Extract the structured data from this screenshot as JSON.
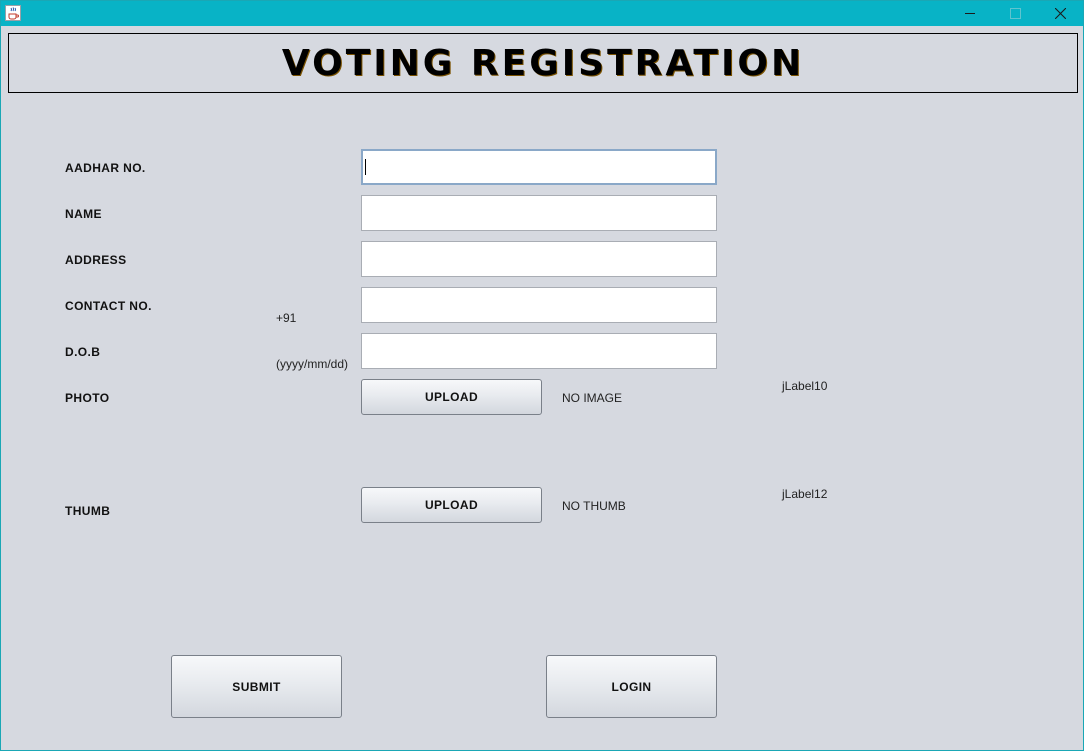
{
  "window": {
    "title": "",
    "controls": {
      "minimize": "minimize",
      "maximize": "maximize",
      "close": "close"
    }
  },
  "header": {
    "title": "VOTING REGISTRATION"
  },
  "form": {
    "aadhar": {
      "label": "AADHAR NO.",
      "value": ""
    },
    "name": {
      "label": "NAME",
      "value": ""
    },
    "address": {
      "label": "ADDRESS",
      "value": ""
    },
    "contact": {
      "label": "CONTACT NO.",
      "prefix": "+91",
      "value": ""
    },
    "dob": {
      "label": "D.O.B",
      "format_hint": "(yyyy/mm/dd)",
      "value": ""
    },
    "photo": {
      "label": "PHOTO",
      "button": "UPLOAD",
      "status": "NO IMAGE",
      "preview": "jLabel10"
    },
    "thumb": {
      "label": "THUMB",
      "button": "UPLOAD",
      "status": "NO THUMB",
      "preview": "jLabel12"
    }
  },
  "actions": {
    "submit": "SUBMIT",
    "login": "LOGIN"
  },
  "colors": {
    "titlebar": "#08b3c6",
    "background": "#d6d9e0",
    "field_focus_border": "#8aa8c8"
  },
  "icons": {
    "app": "java-coffee-cup-icon",
    "minimize": "minimize-icon",
    "maximize": "maximize-icon",
    "close": "close-icon"
  }
}
